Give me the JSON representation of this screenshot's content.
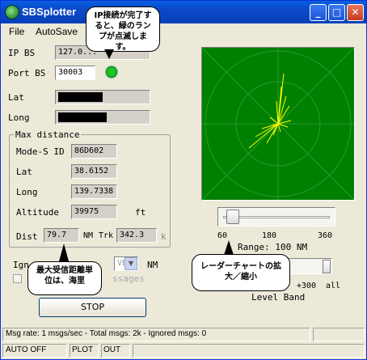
{
  "window": {
    "title": "SBSplotter"
  },
  "menu": {
    "file": "File",
    "autosave": "AutoSave"
  },
  "ip_bs": {
    "label": "IP BS",
    "value": "127.0..."
  },
  "port_bs": {
    "label": "Port BS",
    "value": "30003",
    "led_color": "#1cc41c"
  },
  "lat": {
    "label": "Lat"
  },
  "long": {
    "label": "Long"
  },
  "max_distance": {
    "title": "Max distance",
    "modes_label": "Mode-S ID",
    "modes_value": "86D602",
    "lat_label": "Lat",
    "lat_value": "38.6152",
    "long_label": "Long",
    "long_value": "139.7338",
    "alt_label": "Altitude",
    "alt_value": "39975",
    "alt_unit": "ft",
    "dist_label": "Dist",
    "dist_value": "79.7",
    "dist_unit": "NM",
    "trk_label": "Trk",
    "trk_value": "342.3",
    "trk_unit": "k"
  },
  "ignore": {
    "label": "Ign",
    "select_value": "VER",
    "unit": "NM",
    "checkbox_label": "ssages"
  },
  "stop_button": "STOP",
  "radar": {
    "background_color": "#008000",
    "line_color": "#ffff00"
  },
  "range_slider": {
    "ticks": [
      "60",
      "180",
      "360"
    ],
    "range_text": "Range: 100 NM",
    "value_fraction": 0.05
  },
  "level_band": {
    "scale_labels": [
      "+300",
      "all"
    ],
    "label": "Level Band"
  },
  "balloons": {
    "ip_status": "IP接続が完了すると、緑のランプが点滅します。",
    "dist_unit": "最大受信距離単位は、海里",
    "radar_zoom": "レーダーチャートの拡大／縮小"
  },
  "status_bar": {
    "message": "Msg rate: 1 msgs/sec - Total msgs: 2k - Ignored msgs: 0",
    "cells": [
      "AUTO OFF",
      "PLOT",
      "OUT"
    ]
  }
}
